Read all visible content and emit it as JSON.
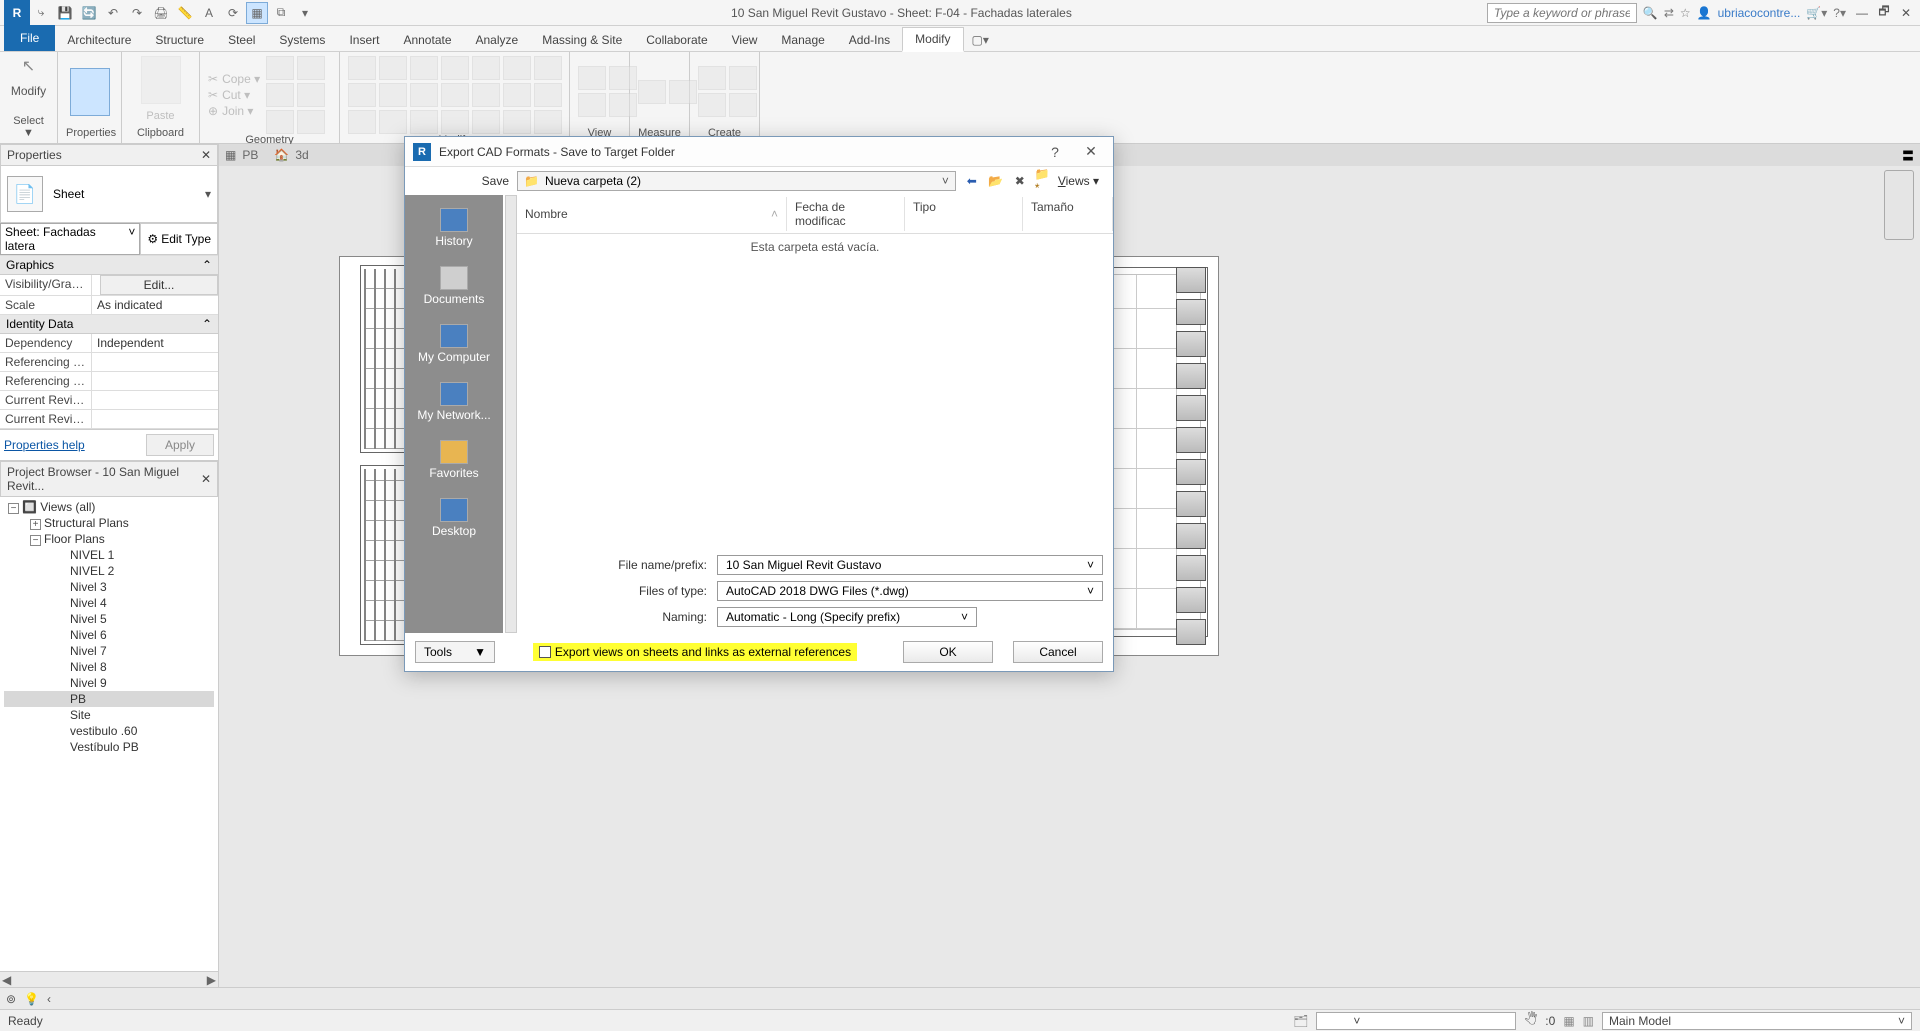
{
  "titlebar": {
    "title": "10 San Miguel Revit Gustavo - Sheet: F-04 - Fachadas laterales",
    "search_placeholder": "Type a keyword or phrase",
    "username": "ubriacocontre..."
  },
  "tabs": {
    "file": "File",
    "items": [
      "Architecture",
      "Structure",
      "Steel",
      "Systems",
      "Insert",
      "Annotate",
      "Analyze",
      "Massing & Site",
      "Collaborate",
      "View",
      "Manage",
      "Add-Ins",
      "Modify"
    ]
  },
  "ribbon": {
    "select": {
      "modify": "Modify",
      "label": "Select ▼"
    },
    "properties": {
      "label": "Properties"
    },
    "clipboard": {
      "paste": "Paste",
      "label": "Clipboard"
    },
    "geometry": {
      "cope": "Cope ▾",
      "cut": "Cut ▾",
      "join": "Join ▾",
      "label": "Geometry"
    },
    "modify": {
      "label": "Modify"
    },
    "view": {
      "label": "View"
    },
    "measure": {
      "label": "Measure"
    },
    "create": {
      "label": "Create"
    }
  },
  "docTabs": {
    "tab1": "PB",
    "tab2": "3d"
  },
  "properties": {
    "title": "Properties",
    "typeName": "Sheet",
    "instance_label": "Sheet: Fachadas latera",
    "edit_type": "Edit Type",
    "cat1": "Graphics",
    "rows1": {
      "vg_k": "Visibility/Grap...",
      "vg_v": "Edit...",
      "scale_k": "Scale",
      "scale_v": "As indicated"
    },
    "cat2": "Identity Data",
    "rows2": {
      "dep_k": "Dependency",
      "dep_v": "Independent",
      "rs_k": "Referencing S...",
      "rs_v": "",
      "rd_k": "Referencing D...",
      "rd_v": "",
      "cr1_k": "Current Revisi...",
      "cr1_v": "",
      "cr2_k": "Current Revisi...",
      "cr2_v": ""
    },
    "help": "Properties help",
    "apply": "Apply"
  },
  "browser": {
    "title": "Project Browser - 10 San Miguel Revit...",
    "views": "Views (all)",
    "structural": "Structural Plans",
    "floor": "Floor Plans",
    "items": [
      "NIVEL 1",
      "NIVEL 2",
      "Nivel 3",
      "Nivel 4",
      "Nivel 5",
      "Nivel 6",
      "Nivel 7",
      "Nivel 8",
      "Nivel 9",
      "PB",
      "Site",
      "vestibulo .60",
      "Vestíbulo PB"
    ]
  },
  "dialog": {
    "title": "Export CAD Formats - Save to Target Folder",
    "save": "Save",
    "folder": "Nueva carpeta (2)",
    "views": "Views",
    "places": {
      "history": "History",
      "documents": "Documents",
      "computer": "My Computer",
      "network": "My Network...",
      "favorites": "Favorites",
      "desktop": "Desktop"
    },
    "cols": {
      "name": "Nombre",
      "date": "Fecha de modificac",
      "type": "Tipo",
      "size": "Tamaño"
    },
    "empty": "Esta carpeta está vacía.",
    "fn_label": "File name/prefix:",
    "fn_value": "10 San Miguel Revit Gustavo",
    "ft_label": "Files of type:",
    "ft_value": "AutoCAD 2018 DWG Files  (*.dwg)",
    "nm_label": "Naming:",
    "nm_value": "Automatic - Long (Specify prefix)",
    "tools": "Tools",
    "chk": "Export views on sheets and links as external references",
    "ok": "OK",
    "cancel": "Cancel"
  },
  "status": {
    "ready": "Ready",
    "zero": ":0",
    "model": "Main Model"
  }
}
